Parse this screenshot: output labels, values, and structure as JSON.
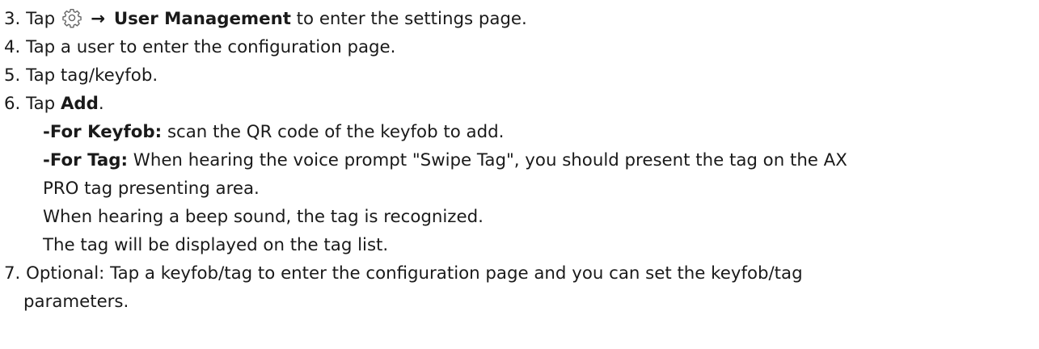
{
  "steps": {
    "s3": {
      "num": "3.",
      "pre": "Tap",
      "icon": "gear-icon",
      "arrow": "→",
      "bold": "User Management",
      "post": " to enter the settings page."
    },
    "s4": {
      "num": "4.",
      "text": "Tap a user to enter the configuration page."
    },
    "s5": {
      "num": "5.",
      "text": "Tap tag/keyfob."
    },
    "s6": {
      "num": "6.",
      "pre": "Tap ",
      "bold": "Add",
      "post": ".",
      "keyfob_label": "-For Keyfob:",
      "keyfob_text": " scan the QR code of the keyfob to add.",
      "tag_label": "-For Tag:",
      "tag_text_1": " When hearing the voice prompt \"Swipe Tag\", you should present the tag on the AX",
      "tag_text_2": "PRO tag presenting area.",
      "beep_text": "When hearing a beep sound, the tag is recognized.",
      "list_text": "The tag will be displayed on the tag list."
    },
    "s7": {
      "num": "7.",
      "text_1": "Optional: Tap a keyfob/tag to enter the configuration page and you can set the keyfob/tag",
      "text_2": "parameters."
    }
  }
}
